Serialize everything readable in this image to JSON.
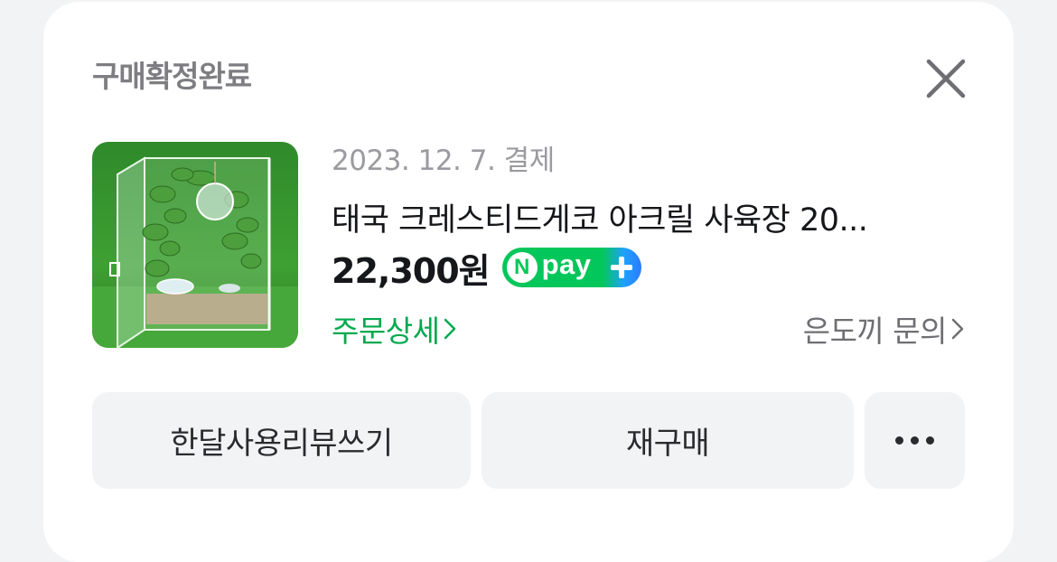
{
  "header": {
    "title": "구매확정완료"
  },
  "order": {
    "date_label": "2023. 12. 7. 결제",
    "product_name": "태국 크레스티드게코 아크릴 사육장 20...",
    "price": "22,300원",
    "npay_badge": {
      "letter": "N",
      "text": "pay"
    },
    "detail_link": "주문상세",
    "seller_inquiry_link": "은도끼 문의"
  },
  "actions": {
    "review_label": "한달사용리뷰쓰기",
    "rebuy_label": "재구매"
  },
  "colors": {
    "accent_green": "#03a94e",
    "npay_green": "#03c75a",
    "npay_blue": "#2b7cff",
    "title_gray": "#7d7d82"
  },
  "icons": {
    "close": "close-icon",
    "chevron": "chevron-right-icon",
    "more": "more-horizontal-icon",
    "npay_plus": "plus-icon"
  }
}
